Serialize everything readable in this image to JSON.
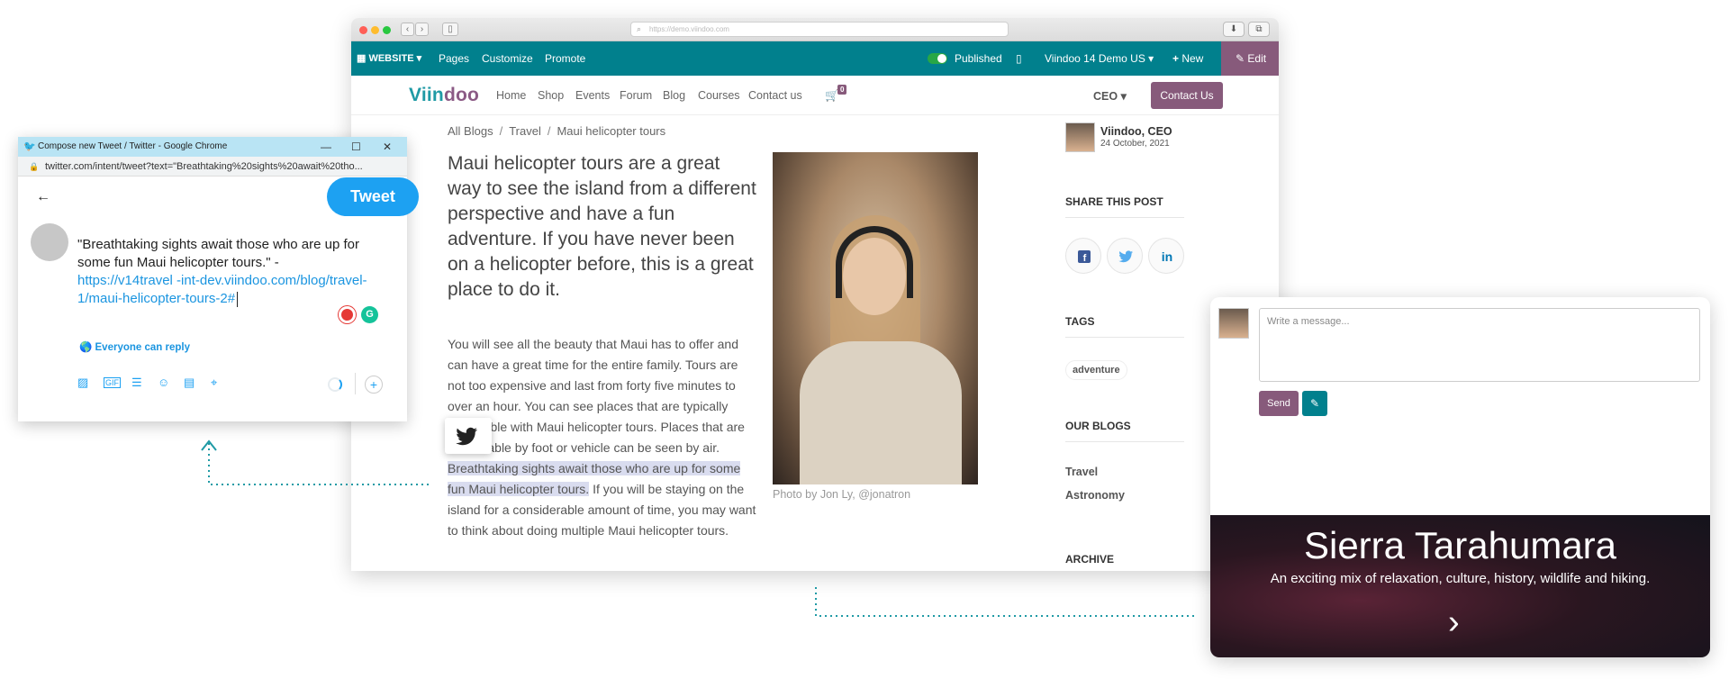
{
  "browser": {
    "controls": {
      "back": "‹",
      "forward": "›",
      "sidebar": "▯"
    },
    "url_placeholder": "https://demo.viindoo.com",
    "toolbar": {
      "website": "WEBSITE",
      "pages": "Pages",
      "customize": "Customize",
      "promote": "Promote",
      "published": "Published",
      "company": "Viindoo 14 Demo US",
      "new": "New",
      "edit": "Edit"
    },
    "nav": {
      "logo_a": "Viin",
      "logo_b": "doo",
      "items": [
        "Home",
        "Shop",
        "Events",
        "Forum",
        "Blog",
        "Courses",
        "Contact us"
      ],
      "cart_count": "0",
      "user_menu": "CEO",
      "contact_button": "Contact Us"
    },
    "breadcrumb": [
      "All Blogs",
      "Travel",
      "Maui helicopter tours"
    ],
    "breadcrumb_sep": "/",
    "lead": "Maui helicopter tours are a great way to see the island from a different perspective and have a fun adventure. If you have never been on a helicopter before, this is a great place to do it.",
    "body_before": "You will see all the beauty that Maui has to offer and can have a great time for the entire family. Tours are not too expensive and last from forty five minutes to over an hour. You can see places that are typically impossible with Maui helicopter tours. Places that are unavailable by foot or vehicle can be seen by air. ",
    "body_highlight": "Breathtaking sights await those who are up for some fun Maui helicopter tours.",
    "body_after": " If you will be staying on the island for a considerable amount of time, you may want to think about doing multiple Maui helicopter tours.",
    "photo_caption": "Photo by Jon Ly, @jonatron",
    "sidebar": {
      "author": "Viindoo, CEO",
      "date": "24 October, 2021",
      "share_heading": "SHARE THIS POST",
      "share_labels": [
        "f",
        "t",
        "in"
      ],
      "tags_heading": "TAGS",
      "tag": "adventure",
      "blogs_heading": "OUR BLOGS",
      "blogs": [
        "Travel",
        "Astronomy"
      ],
      "archive_heading": "ARCHIVE"
    }
  },
  "tweet": {
    "window_title": "Compose new Tweet / Twitter - Google Chrome",
    "url": "twitter.com/intent/tweet?text=\"Breathtaking%20sights%20await%20tho...",
    "button": "Tweet",
    "text": "\"Breathtaking sights await those who are up for some fun Maui helicopter tours.\" -",
    "link": "https://v14travel -int-dev.viindoo.com/blog/travel-1/maui-helicopter-tours-2#",
    "reply": "Everyone can reply",
    "grammarly": "G"
  },
  "card": {
    "placeholder": "Write a message...",
    "send": "Send",
    "banner_title": "Sierra Tarahumara",
    "banner_subtitle": "An exciting mix of relaxation, culture, history, wildlife and hiking."
  },
  "colors": {
    "teal": "#01808d",
    "purple": "#875a7b",
    "twitter_blue": "#1da1f2",
    "highlight": "#d9dcef"
  }
}
